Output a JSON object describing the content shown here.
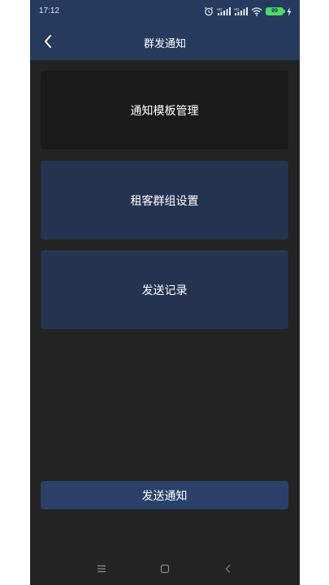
{
  "status_bar": {
    "time": "17:12",
    "battery": "99",
    "icons": [
      "alarm-icon",
      "signal-hd-icon",
      "signal-hd-icon",
      "wifi-icon",
      "battery-icon",
      "charging-icon"
    ]
  },
  "nav": {
    "title": "群发通知",
    "back_icon": "chevron-left-icon"
  },
  "menu": {
    "items": [
      {
        "label": "通知模板管理"
      },
      {
        "label": "租客群组设置"
      },
      {
        "label": "发送记录"
      }
    ]
  },
  "send_button": {
    "label": "发送通知"
  },
  "system_nav": {
    "icons": [
      "menu-icon",
      "home-icon",
      "back-icon"
    ]
  },
  "colors": {
    "header": "#263a5e",
    "background": "#232323",
    "card_dark": "#1a1a1a",
    "card_blue": "#243450",
    "button": "#2a4068",
    "battery": "#4cd964"
  }
}
